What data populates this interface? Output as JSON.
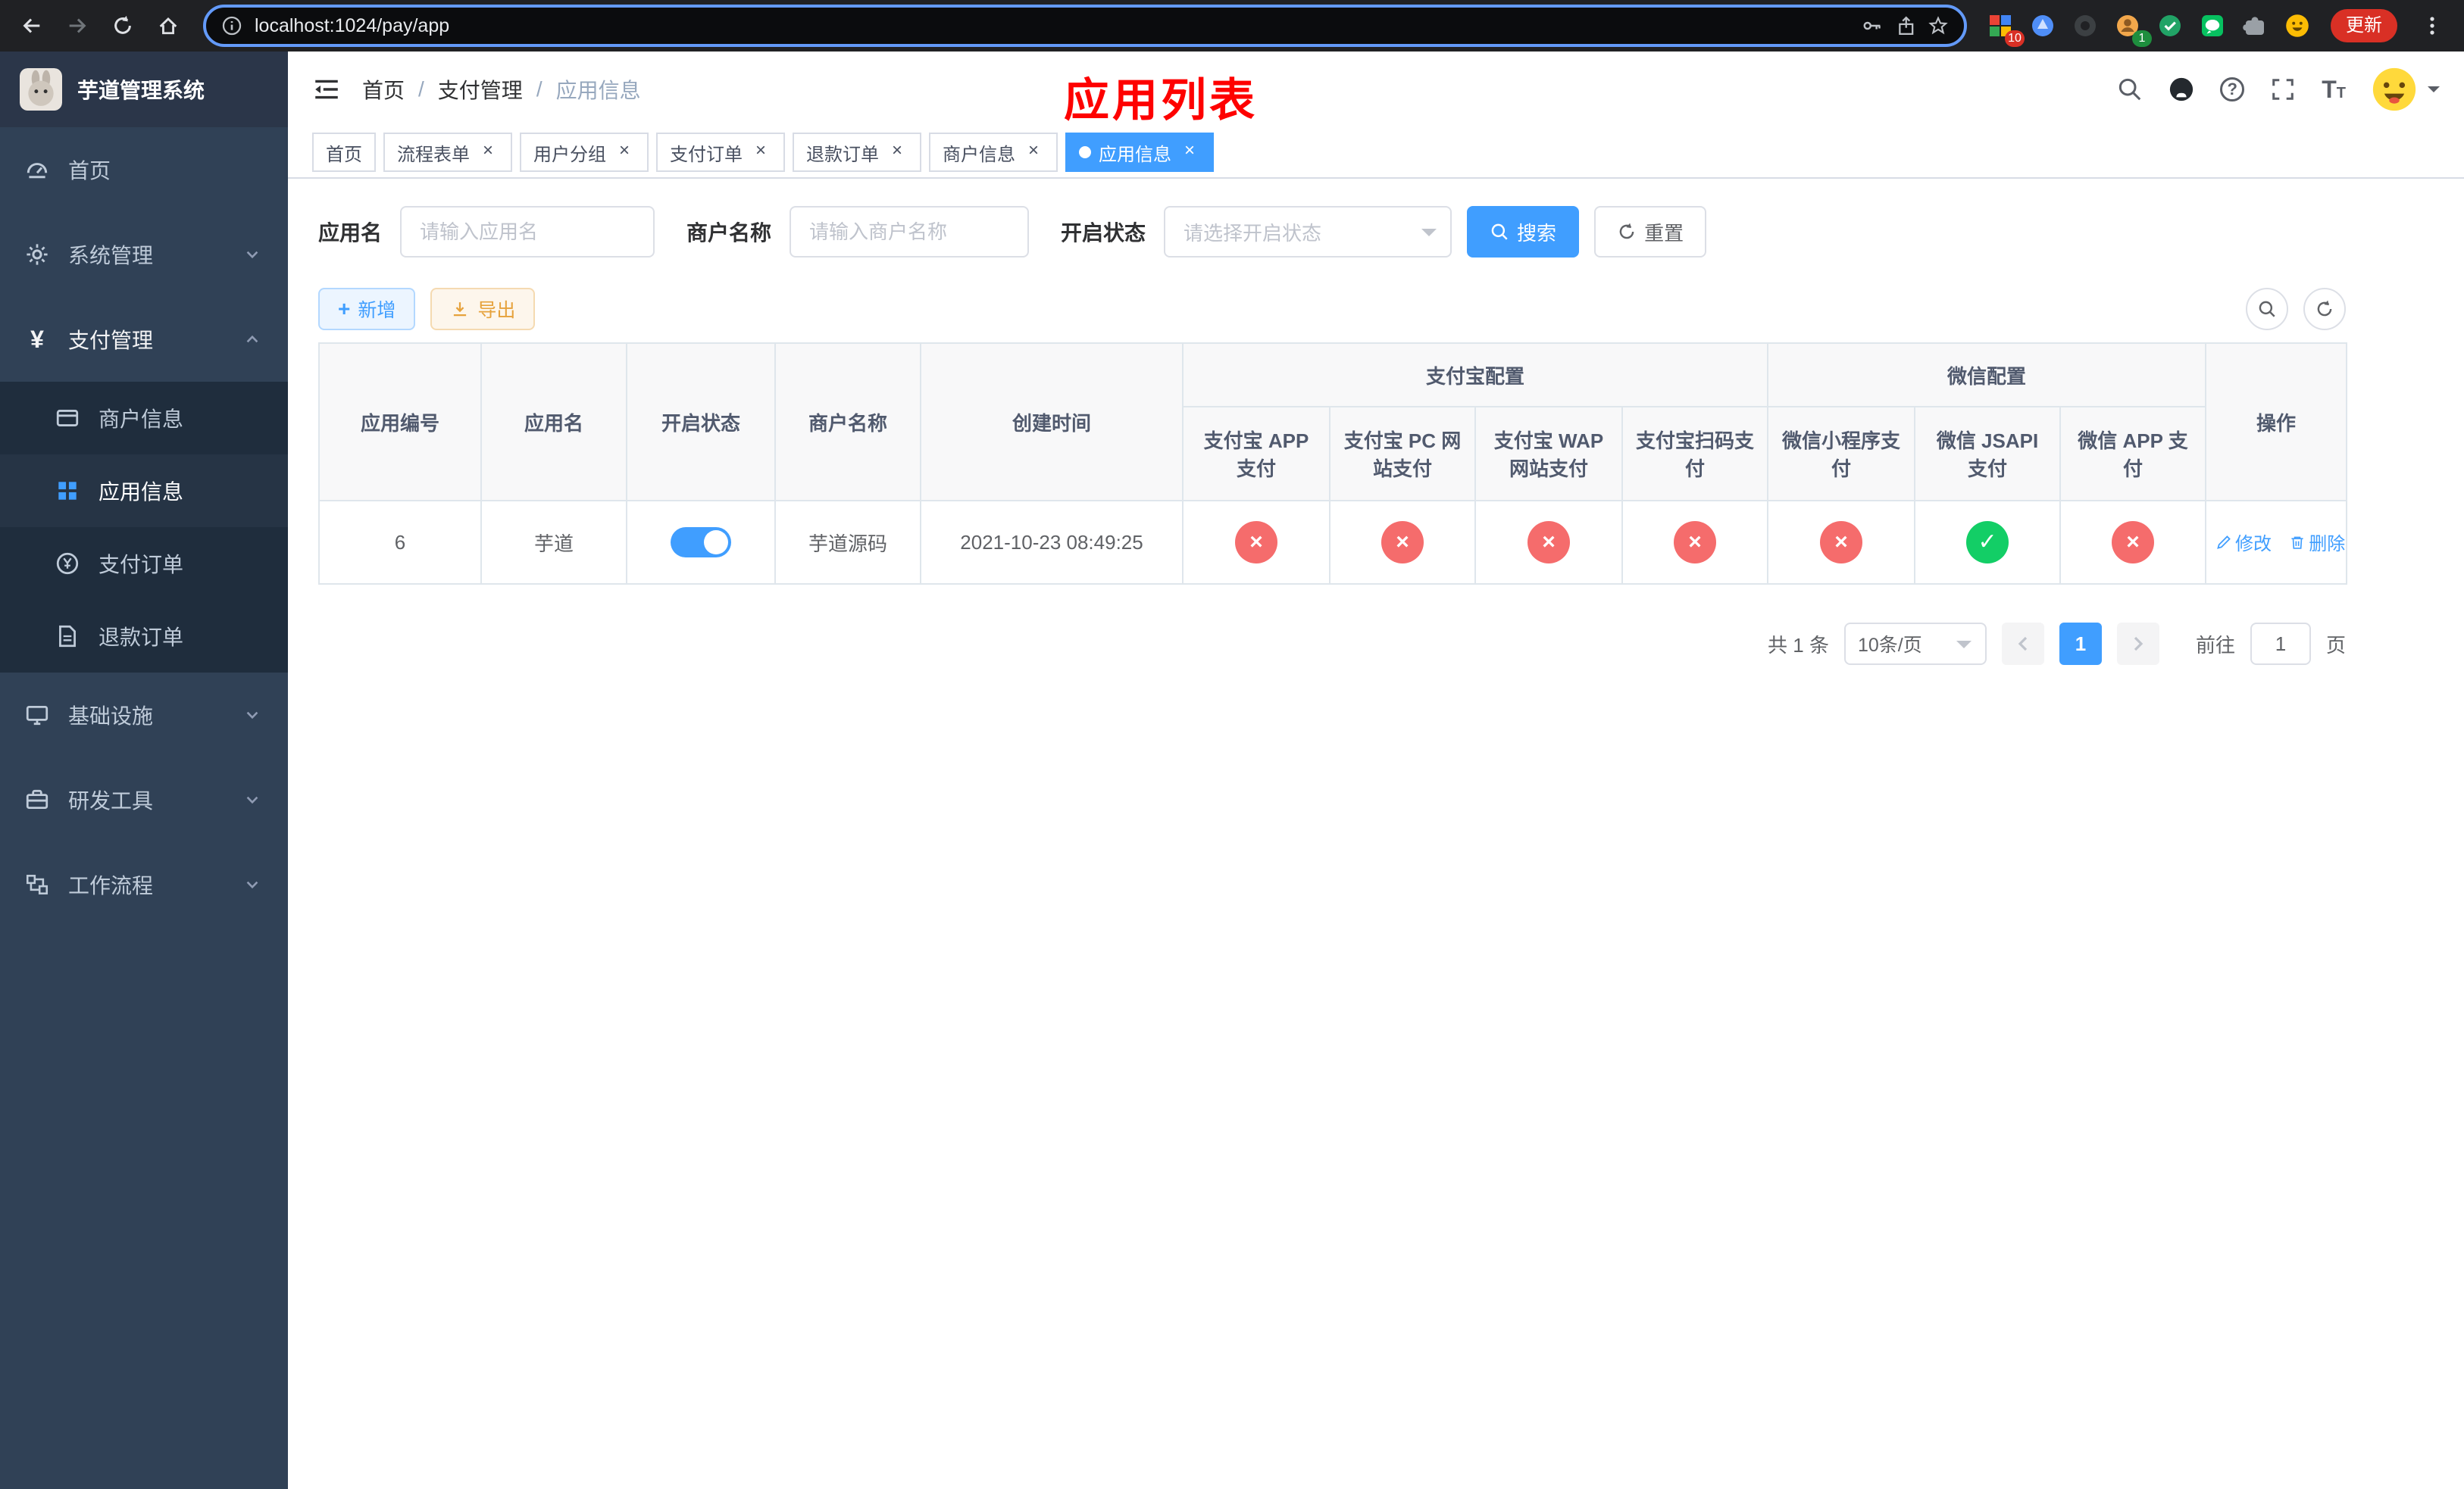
{
  "browser": {
    "url": "localhost:1024/pay/app",
    "update_label": "更新",
    "ext_badge_red": "10",
    "ext_badge_green": "1"
  },
  "sidebar": {
    "title": "芋道管理系统",
    "items": {
      "home": "首页",
      "system": "系统管理",
      "payment": "支付管理",
      "merchant": "商户信息",
      "app": "应用信息",
      "pay_order": "支付订单",
      "refund_order": "退款订单",
      "infra": "基础设施",
      "devtools": "研发工具",
      "workflow": "工作流程"
    }
  },
  "navbar": {
    "breadcrumb": [
      "首页",
      "支付管理",
      "应用信息"
    ],
    "annotation": "应用列表"
  },
  "tabs": [
    {
      "label": "首页"
    },
    {
      "label": "流程表单"
    },
    {
      "label": "用户分组"
    },
    {
      "label": "支付订单"
    },
    {
      "label": "退款订单"
    },
    {
      "label": "商户信息"
    },
    {
      "label": "应用信息"
    }
  ],
  "filters": {
    "app_name_label": "应用名",
    "app_name_placeholder": "请输入应用名",
    "merchant_label": "商户名称",
    "merchant_placeholder": "请输入商户名称",
    "status_label": "开启状态",
    "status_placeholder": "请选择开启状态",
    "search_label": "搜索",
    "reset_label": "重置"
  },
  "toolbar": {
    "add_label": "新增",
    "export_label": "导出"
  },
  "table": {
    "columns": {
      "id": "应用编号",
      "name": "应用名",
      "status": "开启状态",
      "merchant": "商户名称",
      "created": "创建时间",
      "alipay_group": "支付宝配置",
      "wechat_group": "微信配置",
      "action": "操作",
      "alipay": [
        "支付宝 APP 支付",
        "支付宝 PC 网站支付",
        "支付宝 WAP 网站支付",
        "支付宝扫码支付"
      ],
      "wechat": [
        "微信小程序支付",
        "微信 JSAPI 支付",
        "微信 APP 支付"
      ]
    },
    "rows": [
      {
        "id": "6",
        "name": "芋道",
        "enabled": true,
        "merchant": "芋道源码",
        "created": "2021-10-23 08:49:25",
        "channels": [
          "off",
          "off",
          "off",
          "off",
          "off",
          "on",
          "off"
        ],
        "edit_label": "修改",
        "delete_label": "删除"
      }
    ]
  },
  "pagination": {
    "total": "共 1 条",
    "page_size": "10条/页",
    "page": "1",
    "goto_label": "前往",
    "goto_value": "1",
    "page_unit": "页"
  },
  "colors": {
    "accent": "#409eff",
    "danger": "#f56c6c",
    "success": "#13ce66",
    "annotation": "#fe0100"
  }
}
